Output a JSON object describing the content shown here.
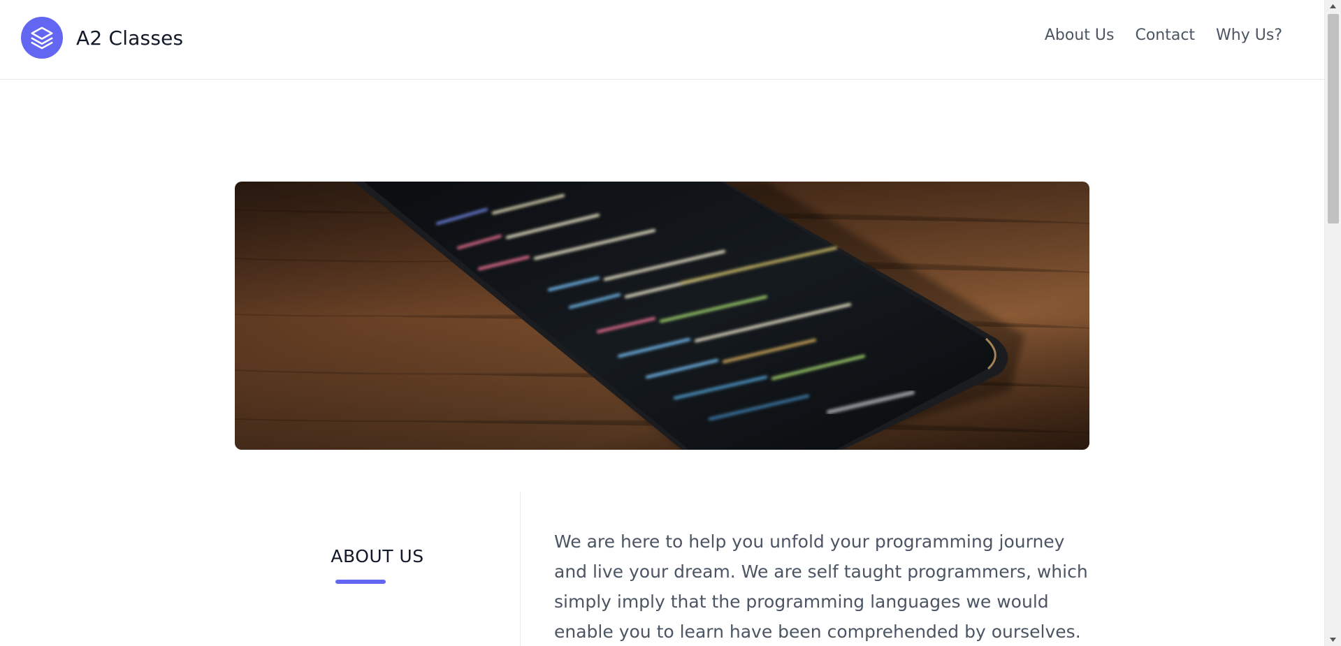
{
  "header": {
    "brand_name": "A2 Classes",
    "logo_icon": "layers-icon",
    "nav": [
      {
        "label": "About Us"
      },
      {
        "label": "Contact"
      },
      {
        "label": "Why Us?"
      }
    ]
  },
  "hero": {
    "image": "smartphone-with-code-on-wooden-table"
  },
  "about": {
    "heading": "ABOUT US",
    "paragraph": "We are here to help you unfold your programming journey and live your dream. We are self taught programmers, which simply imply that the programming languages we would enable you to learn have been comprehended by ourselves. We know how it is"
  },
  "colors": {
    "accent": "#6366f1",
    "text_dark": "#111827",
    "text_muted": "#4b5563",
    "border": "#e5e7eb"
  }
}
